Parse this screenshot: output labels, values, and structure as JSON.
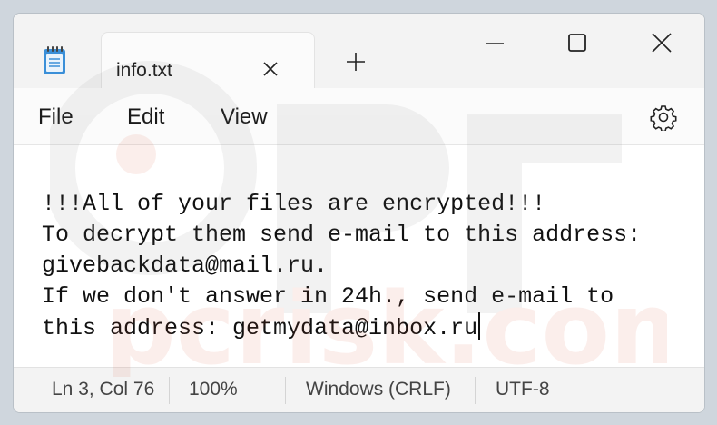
{
  "tab": {
    "title": "info.txt"
  },
  "menu": {
    "file": "File",
    "edit": "Edit",
    "view": "View"
  },
  "editor": {
    "lines": [
      "!!!All of your files are encrypted!!!",
      "To decrypt them send e-mail to this address:",
      "givebackdata@mail.ru.",
      "If we don't answer in 24h., send e-mail to",
      "this address: getmydata@inbox.ru"
    ]
  },
  "status": {
    "position": "Ln 3, Col 76",
    "zoom": "100%",
    "line_ending": "Windows (CRLF)",
    "encoding": "UTF-8"
  },
  "icons": {
    "app": "notepad-icon",
    "close_tab": "close-icon",
    "new_tab": "plus-icon",
    "minimize": "minimize-icon",
    "maximize": "maximize-icon",
    "close_window": "close-icon",
    "settings": "gear-icon"
  },
  "colors": {
    "titlebar": "#f3f3f3",
    "editor_bg": "#ffffff",
    "text": "#111111",
    "app_icon": "#3a8fd8"
  },
  "watermark": {
    "text": "pcrisk.com"
  }
}
